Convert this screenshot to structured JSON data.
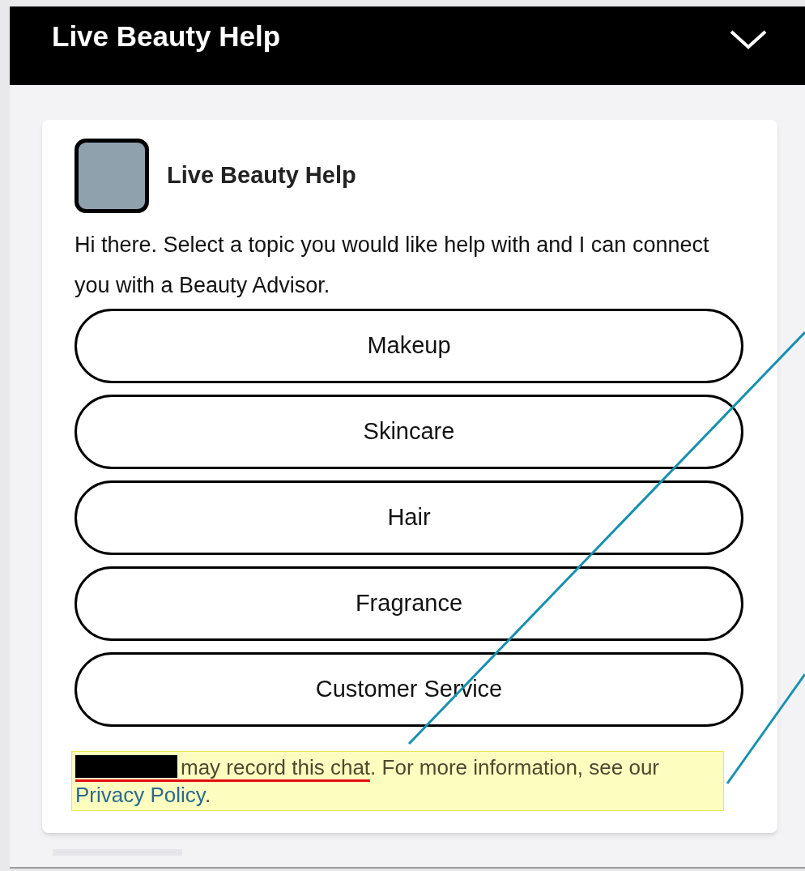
{
  "header": {
    "title": "Live Beauty Help"
  },
  "card": {
    "agent_name": "Live Beauty Help",
    "greeting": "Hi there. Select a topic you would like help with and I can connect you with a Beauty Advisor.",
    "topics": [
      "Makeup",
      "Skincare",
      "Hair",
      "Fragrance",
      "Customer Service"
    ],
    "notice": {
      "underlined": "may record this chat",
      "text": ". For more information, see our ",
      "link": "Privacy Policy",
      "end": "."
    }
  }
}
